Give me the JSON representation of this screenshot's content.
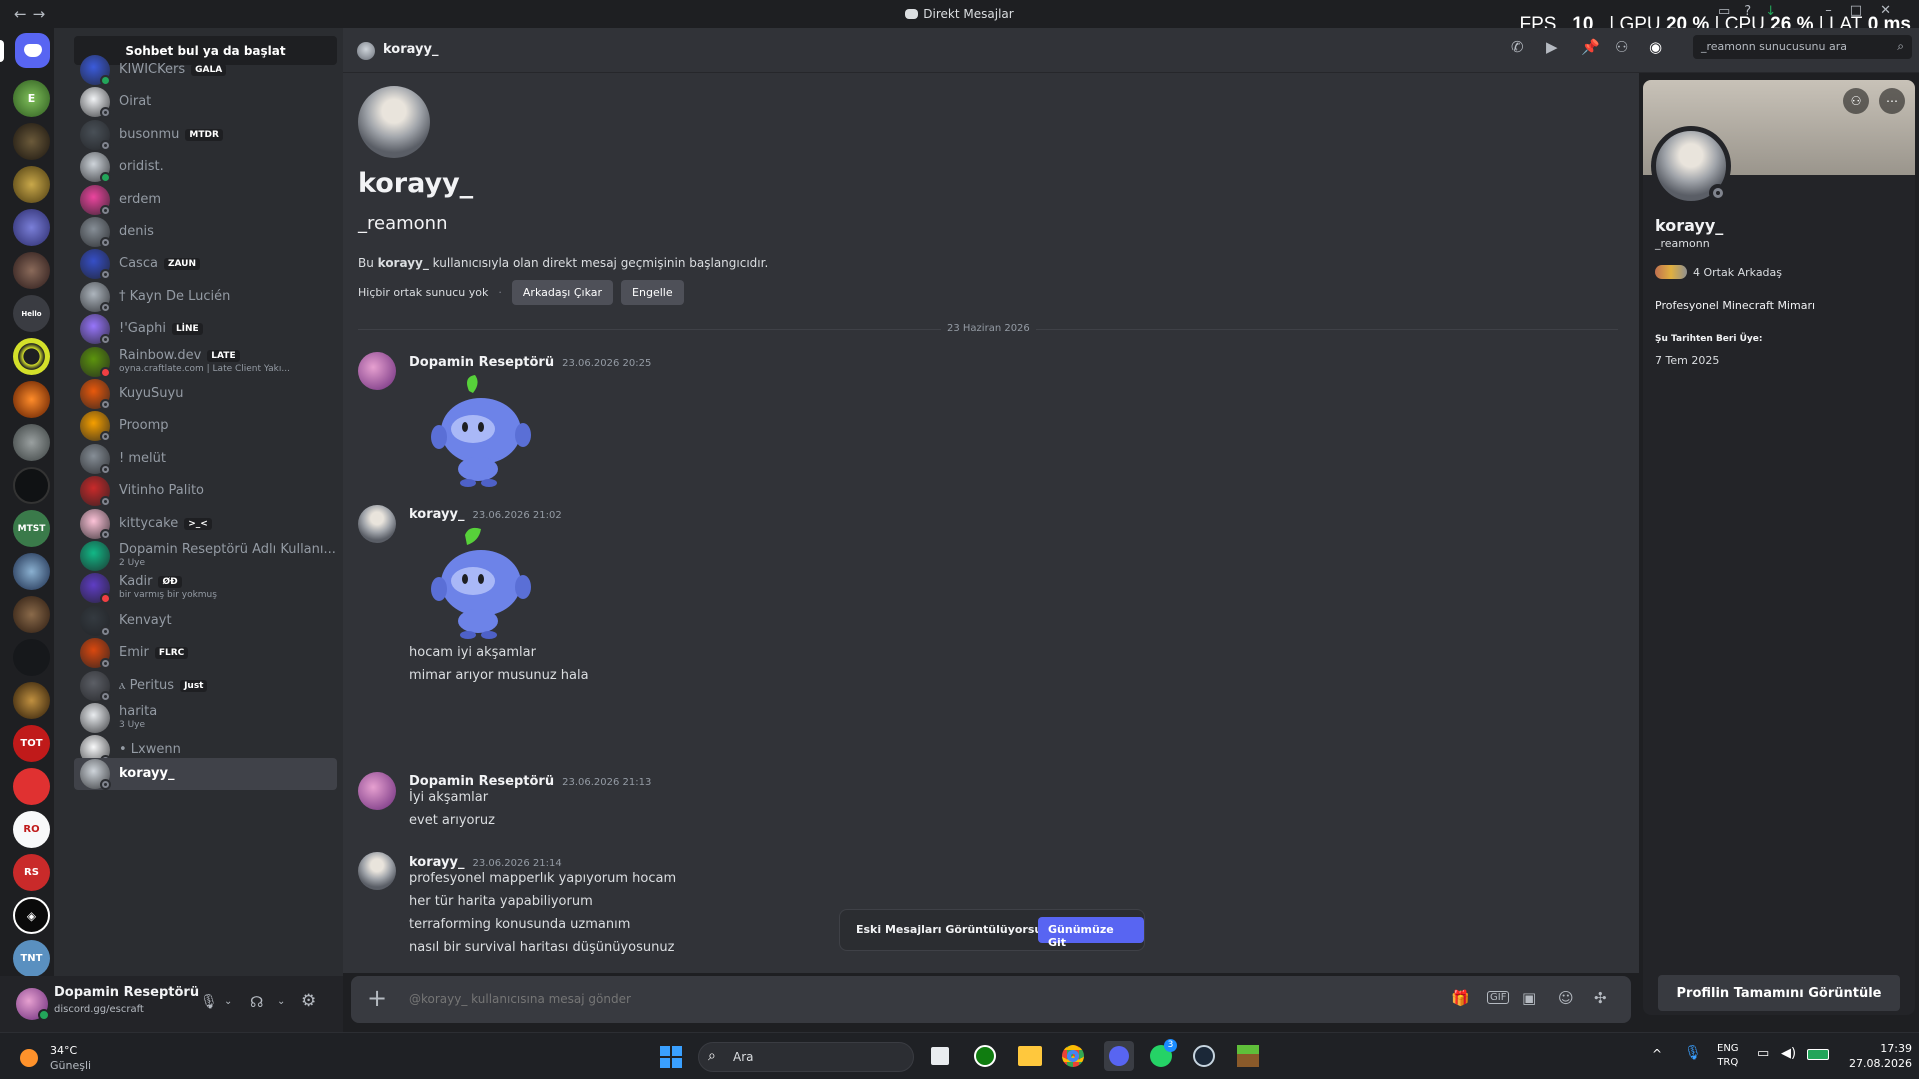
{
  "window": {
    "title": "Direkt Mesajlar",
    "back": "←",
    "forward": "→"
  },
  "overlay": {
    "fps_label": "FPS",
    "fps_value": "10",
    "gpu_label": "GPU",
    "gpu_value": "20 %",
    "cpu_label": "CPU",
    "cpu_value": "26 %",
    "lat_label": "LAT",
    "lat_value": "0 ms"
  },
  "dm_list": {
    "search_label": "Sohbet bul ya da başlat",
    "items": [
      {
        "name": "KIWICKers",
        "tag": "GALA",
        "status": "online",
        "color": "#3b5bdb"
      },
      {
        "name": "Oirat",
        "tag": "",
        "status": "offline",
        "color": "#f1f3f5"
      },
      {
        "name": "busonmu",
        "tag": "MTDR",
        "status": "offline",
        "color": "#495057"
      },
      {
        "name": "oridist.",
        "tag": "",
        "status": "online",
        "color": "#ced4da"
      },
      {
        "name": "erdem",
        "tag": "",
        "status": "offline",
        "color": "#eb459e"
      },
      {
        "name": "denis",
        "tag": "",
        "status": "offline",
        "color": "#868e96"
      },
      {
        "name": "Casca",
        "tag": "ZAUN",
        "status": "offline",
        "color": "#364fc7"
      },
      {
        "name": "† Kayn De Lucién",
        "tag": "",
        "status": "offline",
        "color": "#adb5bd"
      },
      {
        "name": "!'Gaphi",
        "tag": "LİNE",
        "status": "offline",
        "color": "#9775fa"
      },
      {
        "name": "Rainbow.dev",
        "tag": "LATE",
        "sub": "oyna.craftlate.com | Late Client Yakı...",
        "status": "dnd",
        "color": "#5c940d"
      },
      {
        "name": "KuyuSuyu",
        "tag": "",
        "status": "offline",
        "color": "#e8590c"
      },
      {
        "name": "Proomp",
        "tag": "",
        "status": "offline",
        "color": "#f59f00"
      },
      {
        "name": "! melüt",
        "tag": "",
        "status": "offline",
        "color": "#868e96"
      },
      {
        "name": "Vitinho Palito",
        "tag": "",
        "status": "offline",
        "color": "#c92a2a"
      },
      {
        "name": "kittycake",
        "tag": ">_<",
        "status": "offline",
        "color": "#fcc2d7"
      },
      {
        "name": "Dopamin Reseptörü Adlı Kullanı...",
        "tag": "",
        "sub": "2 Üye",
        "status": "group",
        "color": "#12b886"
      },
      {
        "name": "Kadir",
        "tag": "ØÐ",
        "sub": "bir varmış bir yokmuş",
        "status": "dnd",
        "color": "#5f3dc4"
      },
      {
        "name": "Kenvayt",
        "tag": "",
        "status": "offline",
        "color": "#343a40"
      },
      {
        "name": "Emir",
        "tag": "FLRC",
        "status": "offline",
        "color": "#d9480f"
      },
      {
        "name": "ⲁ Peritus",
        "tag": "Just",
        "status": "offline",
        "color": "#5c5f66"
      },
      {
        "name": "harita",
        "tag": "",
        "sub": "3 Üye",
        "status": "group",
        "color": "#e9ecef"
      },
      {
        "name": "• Lxwenn",
        "tag": "",
        "status": "offline",
        "color": "#f8f9fa"
      },
      {
        "name": "korayy_",
        "tag": "",
        "status": "offline",
        "color": "#ced4da",
        "selected": true
      }
    ]
  },
  "user_panel": {
    "name": "Dopamin Reseptörü",
    "status": "discord.gg/escraft"
  },
  "header": {
    "name": "korayy_",
    "search_placeholder": "_reamonn sunucusunu ara"
  },
  "intro": {
    "display_name": "korayy_",
    "username": "_reamonn",
    "desc_prefix": "Bu ",
    "desc_name": "korayy_",
    "desc_suffix": " kullanıcısıyla olan direkt mesaj geçmişinin başlangıcıdır.",
    "no_mutual": "Hiçbir ortak sunucu yok",
    "dot": "·",
    "remove_friend": "Arkadaşı Çıkar",
    "block": "Engelle"
  },
  "date_divider": "23 Haziran 2026",
  "messages": [
    {
      "author": "Dopamin Reseptörü",
      "time": "23.06.2026 20:25",
      "lines": []
    },
    {
      "author": "korayy_",
      "time": "23.06.2026 21:02",
      "lines": [
        "hocam iyi akşamlar",
        "mimar arıyor musunuz hala"
      ]
    },
    {
      "author": "Dopamin Reseptörü",
      "time": "23.06.2026 21:13",
      "lines": [
        "İyi akşamlar",
        "evet arıyoruz"
      ]
    },
    {
      "author": "korayy_",
      "time": "23.06.2026 21:14",
      "lines": [
        "profesyonel mapperlık yapıyorum hocam",
        "her tür harita yapabiliyorum",
        "terraforming konusunda uzmanım",
        "nasıl bir survival haritası düşünüyosunuz"
      ]
    }
  ],
  "old_messages": {
    "label": "Eski Mesajları Görüntülüyorsun",
    "button": "Günümüze Git"
  },
  "composer": {
    "placeholder": "@korayy_ kullanıcısına mesaj gönder",
    "add": "+"
  },
  "profile": {
    "display_name": "korayy_",
    "username": "_reamonn",
    "mutual_friends": "4 Ortak Arkadaş",
    "bio": "Profesyonel Minecraft Mimarı",
    "member_since_label": "Şu Tarihten Beri Üye:",
    "member_since": "7 Tem 2025",
    "view_full": "Profilin Tamamını Görüntüle",
    "banner_color": "#c8c2b8"
  },
  "taskbar": {
    "temp": "34°C",
    "weather": "Güneşli",
    "search": "Ara",
    "lang1": "ENG",
    "lang2": "TRQ",
    "time": "17:39",
    "date": "27.08.2026",
    "badge": "3"
  },
  "colors": {
    "blurple": "#5865f2",
    "online": "#23a55a",
    "dnd": "#f23f43",
    "offline": "#80848e"
  }
}
